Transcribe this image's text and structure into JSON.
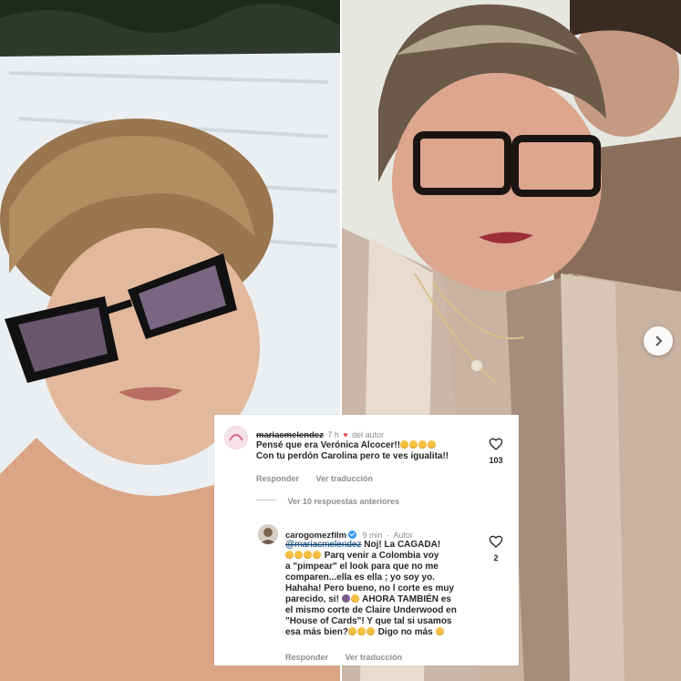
{
  "comment_1": {
    "username": "mariacmelendez",
    "time": "7 h",
    "author_tag": "del autor",
    "text_line1": "Pensé que era Verónica Alcocer!!",
    "text_line2": "Con tu perdón Carolina pero te ves igualita!!",
    "reply_label": "Responder",
    "translation_label": "Ver traducción",
    "likes": "103"
  },
  "view_replies_label": "Ver 10 respuestas anteriores",
  "comment_2": {
    "username": "carogomezfilm",
    "time": "9 min",
    "author_tag": "Autor",
    "mention": "@mariacmelendez",
    "line1": "Noj! La CAGADA!",
    "line2": "Parq venir a Colombia voy",
    "line3": "a \"pimpear\" el look para que no me",
    "line4": "comparen...ella es ella ; yo soy yo.",
    "line5": "Hahaha! Pero bueno, no l corte es muy",
    "line6": "parecido, si!",
    "line6b": "AHORA TAMBIÉN es",
    "line7": "el mismo corte de Claire Underwood en",
    "line8": "\"House of Cards\"! Y que tal si usamos",
    "line9": "esa más bien?",
    "line9b": "Digo no más",
    "reply_label": "Responder",
    "translation_label": "Ver traducción",
    "likes": "2"
  },
  "colors": {
    "heart_red": "#ed4956",
    "verified_blue": "#3897f0",
    "meta_gray": "#8e8e8e"
  },
  "icons": [
    "heart-icon",
    "verified-badge-icon",
    "chevron-right-icon",
    "emoji-icon"
  ]
}
